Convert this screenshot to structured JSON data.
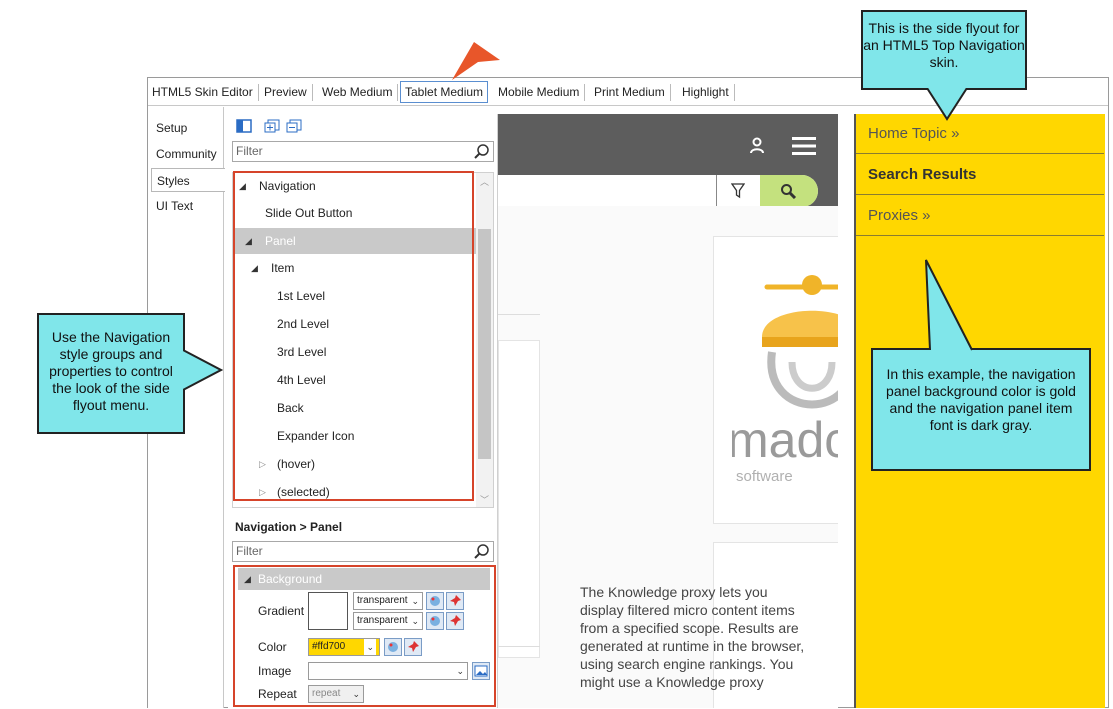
{
  "tabs": [
    {
      "label": "HTML5 Skin Editor"
    },
    {
      "label": "Preview"
    },
    {
      "label": "Web Medium"
    },
    {
      "label": "Tablet Medium"
    },
    {
      "label": "Mobile Medium"
    },
    {
      "label": "Print Medium"
    },
    {
      "label": "Highlight"
    }
  ],
  "left_tabs": [
    {
      "label": "Setup"
    },
    {
      "label": "Community"
    },
    {
      "label": "Styles"
    },
    {
      "label": "UI Text"
    }
  ],
  "styles_panel": {
    "filter_placeholder": "Filter",
    "tree": [
      {
        "label": "Navigation"
      },
      {
        "label": "Slide Out Button"
      },
      {
        "label": "Panel"
      },
      {
        "label": "Item"
      },
      {
        "label": "1st Level"
      },
      {
        "label": "2nd Level"
      },
      {
        "label": "3rd Level"
      },
      {
        "label": "4th Level"
      },
      {
        "label": "Back"
      },
      {
        "label": "Expander Icon"
      },
      {
        "label": "(hover)"
      },
      {
        "label": "(selected)"
      }
    ],
    "breadcrumb": "Navigation > Panel",
    "props_filter_placeholder": "Filter",
    "group": "Background",
    "gradient_label": "Gradient",
    "gradient_value_1": "transparent",
    "gradient_value_2": "transparent",
    "color_label": "Color",
    "color_value": "#ffd700",
    "image_label": "Image",
    "repeat_label": "Repeat",
    "repeat_value": "repeat"
  },
  "preview": {
    "logo_word": "madcap",
    "logo_sub": "software",
    "body_text": "The Knowledge proxy lets you display filtered micro content items from a specified scope. Results are generated at runtime in the browser, using search engine rankings. You might use a Knowledge proxy"
  },
  "flyout": {
    "items": [
      {
        "label": "Home Topic  »"
      },
      {
        "label": "Search Results"
      },
      {
        "label": "Proxies  »"
      }
    ],
    "background": "#ffd700"
  },
  "callouts": {
    "top": "This is the side flyout for an HTML5 Top Navigation skin.",
    "left": "Use the Navigation style groups and properties to control the look of the side flyout menu.",
    "right": "In this example, the navigation panel background color is gold and the navigation panel item font is dark gray."
  },
  "colors": {
    "callout": "#80e6ea",
    "highlight": "#d6442a",
    "flyout": "#ffd700"
  }
}
